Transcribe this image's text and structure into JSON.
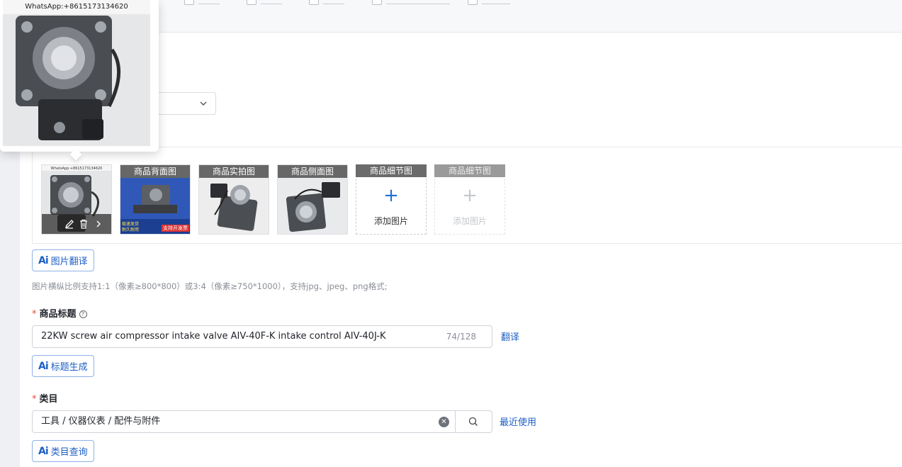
{
  "preview": {
    "watermark": "WhatsApp:+8615173134620"
  },
  "images": {
    "main_thumb_watermark": "WhatsApp:+8615173134620",
    "slots": [
      {
        "caption": "商品背面图",
        "banner_left": "极速发货",
        "banner_left2": "耐久耐用",
        "banner_right": "支持开发票"
      },
      {
        "caption": "商品实拍图"
      },
      {
        "caption": "商品侧面图"
      }
    ],
    "add_slots": [
      {
        "caption": "商品细节图",
        "plus": "+",
        "label": "添加图片",
        "enabled": true
      },
      {
        "caption": "商品细节图",
        "plus": "+",
        "label": "添加图片",
        "enabled": false
      }
    ]
  },
  "ai_buttons": {
    "image_translate": "图片翻译",
    "title_generate": "标题生成",
    "category_query": "类目查询",
    "ai_mark": "Ai"
  },
  "hint": "图片横纵比例支持1:1（像素≥800*800）或3:4（像素≥750*1000），支持jpg、jpeg、png格式;",
  "title_field": {
    "label": "商品标题",
    "required_mark": "*",
    "value": "22KW screw air compressor intake valve AIV-40F-K intake control  AIV-40J-K",
    "count": "74/128",
    "translate_link": "翻译"
  },
  "category_field": {
    "label": "类目",
    "required_mark": "*",
    "value": "工具 / 仪器仪表 / 配件与附件",
    "recent_link": "最近使用"
  },
  "colors": {
    "accent": "#1d5fc4",
    "required": "#e34d3f"
  }
}
